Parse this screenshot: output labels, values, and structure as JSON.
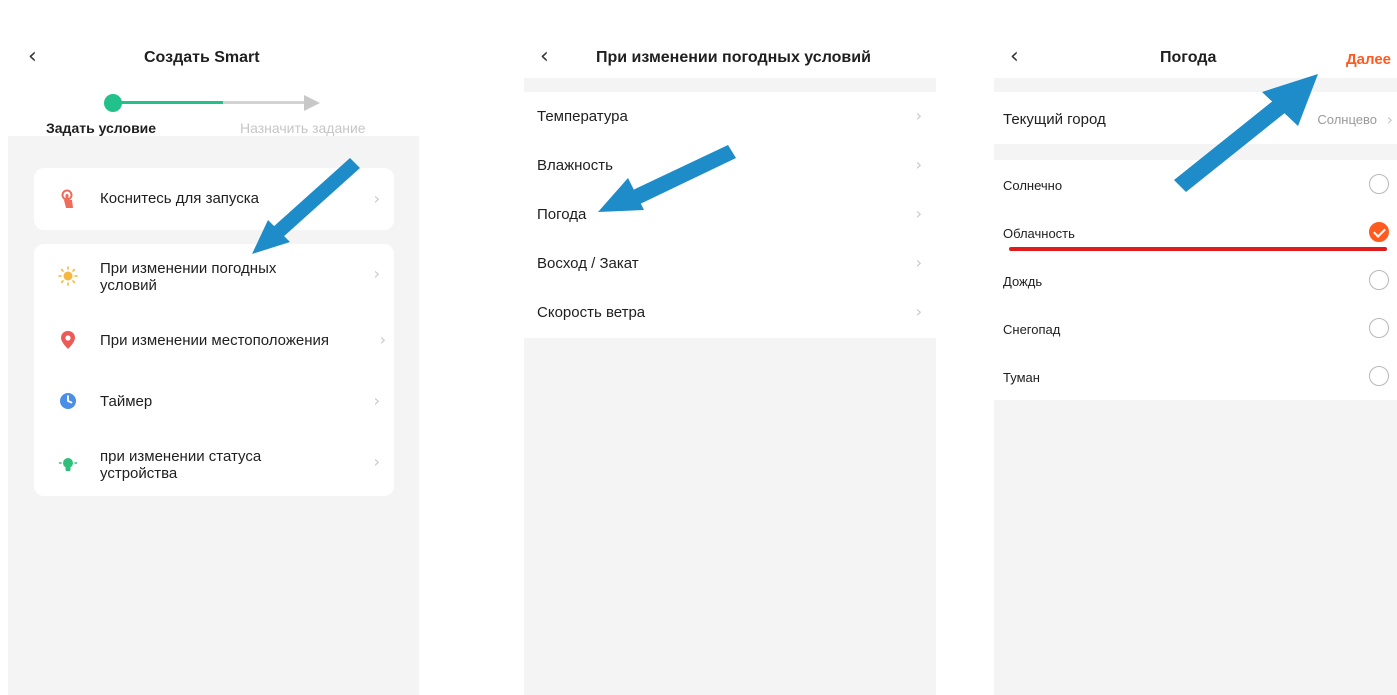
{
  "screen1": {
    "back_icon": "chevron-left-icon",
    "title": "Создать Smart",
    "steps": [
      "Задать условие",
      "Назначить задание"
    ],
    "accent_color": "#22c08a",
    "card_touch": {
      "label": "Коснитесь для запуска",
      "icon": "hand-tap-icon"
    },
    "items": [
      {
        "label": "При изменении погодных условий",
        "icon": "sun-icon"
      },
      {
        "label": "При изменении местоположения",
        "icon": "location-pin-icon"
      },
      {
        "label": "Таймер",
        "icon": "clock-icon"
      },
      {
        "label": "при изменении статуса устройства",
        "icon": "device-status-icon"
      }
    ]
  },
  "screen2": {
    "back_icon": "chevron-left-icon",
    "title": "При изменении погодных условий",
    "items": [
      "Температура",
      "Влажность",
      "Погода",
      "Восход / Закат",
      "Скорость ветра"
    ]
  },
  "screen3": {
    "back_icon": "chevron-left-icon",
    "title": "Погода",
    "next_label": "Далее",
    "next_color": "#ff5a1f",
    "city_label": "Текущий город",
    "city_value": "Солнцево",
    "options": [
      {
        "label": "Солнечно",
        "checked": false
      },
      {
        "label": "Облачность",
        "checked": true
      },
      {
        "label": "Дождь",
        "checked": false
      },
      {
        "label": "Снегопад",
        "checked": false
      },
      {
        "label": "Туман",
        "checked": false
      }
    ]
  },
  "annotation_color": "#1e8cc8"
}
